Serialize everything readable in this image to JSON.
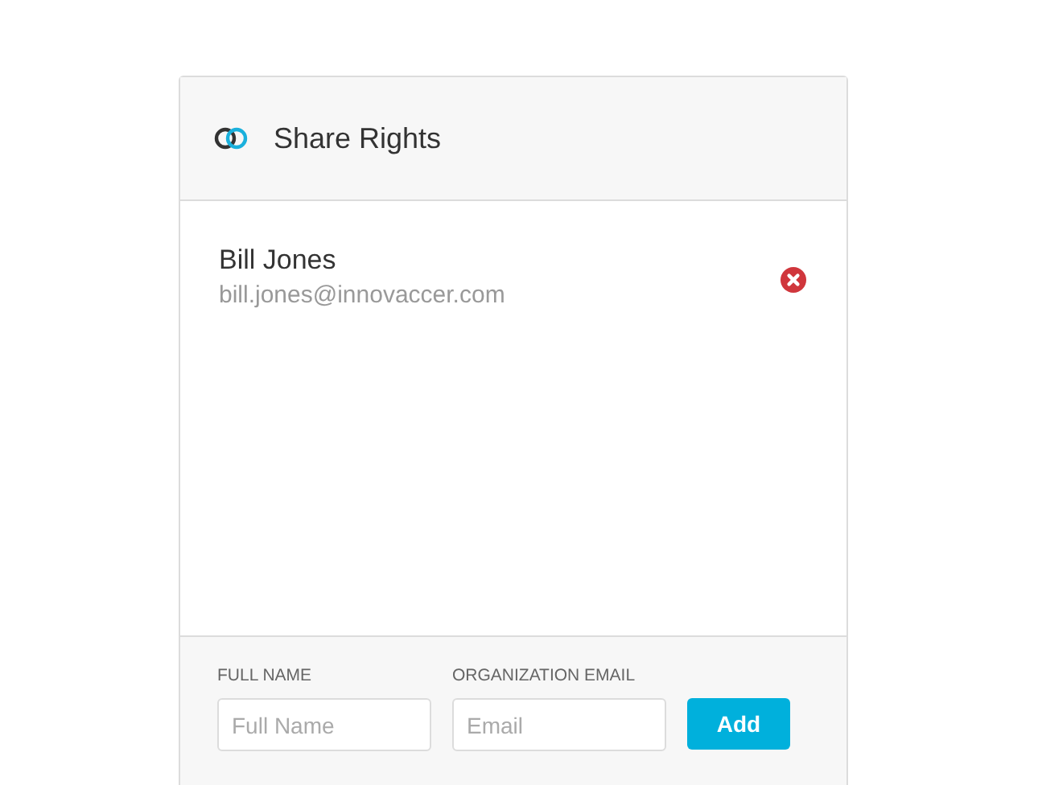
{
  "header": {
    "title": "Share Rights"
  },
  "users": [
    {
      "name": "Bill Jones",
      "email": "bill.jones@innovaccer.com"
    }
  ],
  "form": {
    "fields": [
      {
        "label": "FULL NAME",
        "placeholder": "Full Name"
      },
      {
        "label": "ORGANIZATION EMAIL",
        "placeholder": "Email"
      }
    ],
    "button": "Add"
  }
}
